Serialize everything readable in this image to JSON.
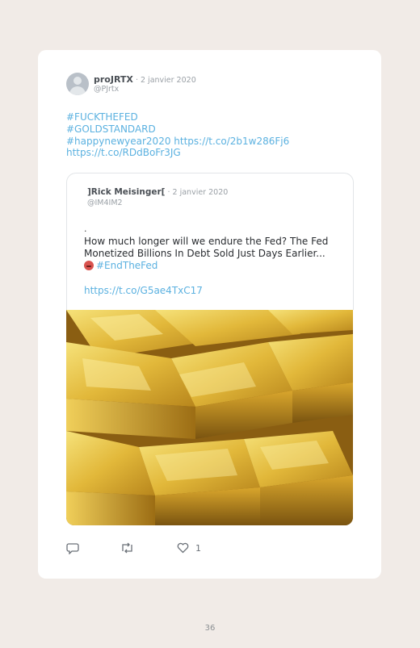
{
  "tweet": {
    "author_name": "proJRTX",
    "separator": " · ",
    "date": "2 janvier 2020",
    "handle": "@PJrtx",
    "lines": [
      "#FUCKTHEFED",
      "#GOLDSTANDARD",
      "#happynewyear2020 https://t.co/2b1w286Fj6",
      "https://t.co/RDdBoFr3JG"
    ]
  },
  "quoted": {
    "author_name": "]Rick Meisinger[",
    "separator": " · ",
    "date": "2 janvier 2020",
    "handle": "@IM4IM2",
    "dot": ".",
    "text": "How much longer will we endure the Fed? The Fed Monetized Billions In Debt Sold Just Days Earlier...",
    "hashtag": "#EndTheFed",
    "link": "https://t.co/G5ae4TxC17"
  },
  "media": {
    "icon": "gold-bars-photo"
  },
  "actions": {
    "reply_icon": "reply-icon",
    "retweet_icon": "retweet-icon",
    "like_icon": "heart-icon",
    "like_count": "1"
  },
  "footer": {
    "page_number": "36"
  },
  "colors": {
    "background": "#f1ebe7",
    "card": "#ffffff",
    "link": "#5bb1e0"
  }
}
